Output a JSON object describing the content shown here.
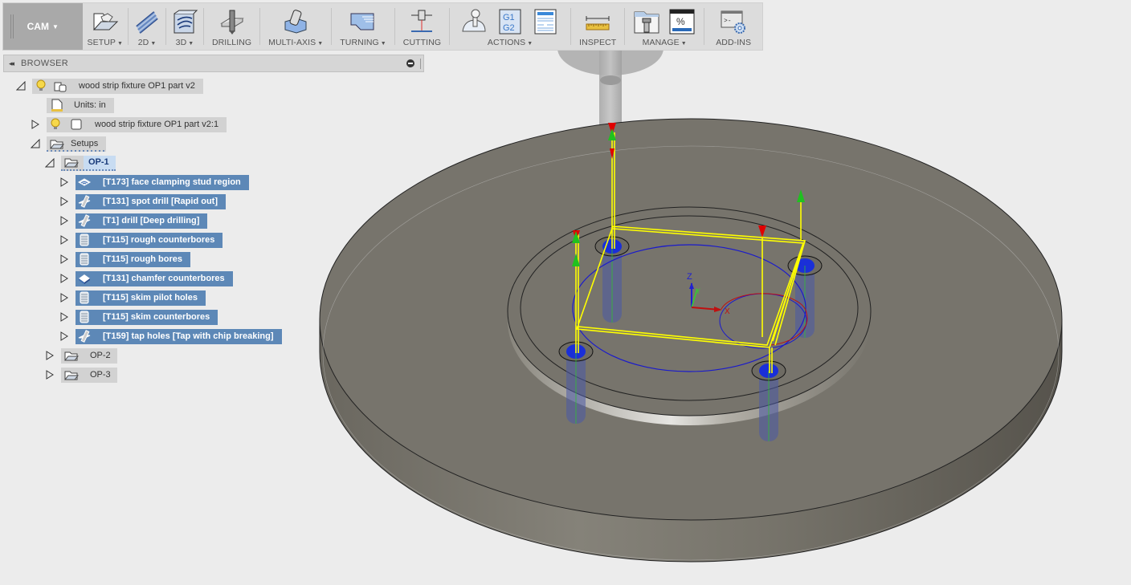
{
  "toolbar": {
    "workspace": "CAM",
    "groups": [
      {
        "label": "SETUP",
        "dropdown": true
      },
      {
        "label": "2D",
        "dropdown": true
      },
      {
        "label": "3D",
        "dropdown": true
      },
      {
        "label": "DRILLING",
        "dropdown": false
      },
      {
        "label": "MULTI-AXIS",
        "dropdown": true
      },
      {
        "label": "TURNING",
        "dropdown": true
      },
      {
        "label": "CUTTING",
        "dropdown": false
      },
      {
        "label": "ACTIONS",
        "dropdown": true
      },
      {
        "label": "INSPECT",
        "dropdown": false
      },
      {
        "label": "MANAGE",
        "dropdown": true
      },
      {
        "label": "ADD-INS",
        "dropdown": false
      }
    ],
    "icons": {
      "setup": "setup-icon",
      "2d": "2d-toolpath-icon",
      "3d": "3d-toolpath-icon",
      "drilling": "drilling-icon",
      "multiaxis": "multi-axis-icon",
      "turning": "turning-icon",
      "cutting": "cutting-icon",
      "actions": [
        "simulate-icon",
        "post-process-g1g2-icon",
        "setup-sheet-icon"
      ],
      "inspect": "measure-icon",
      "manage": [
        "tool-library-icon",
        "task-manager-icon"
      ],
      "addins": "scripts-addins-icon"
    },
    "caret": "▼"
  },
  "browser": {
    "title": "BROWSER",
    "collapse_glyph": "◂◂",
    "tree": {
      "root": "wood strip fixture OP1 part v2",
      "units": "Units: in",
      "component": "wood strip fixture OP1 part v2:1",
      "setups": "Setups",
      "op1": "OP-1",
      "operations": [
        {
          "label": "[T173] face clamping stud region",
          "icon": "face-operation-icon"
        },
        {
          "label": "[T131] spot drill [Rapid out]",
          "icon": "drill-operation-icon"
        },
        {
          "label": "[T1] drill [Deep drilling]",
          "icon": "drill-operation-icon"
        },
        {
          "label": "[T115] rough counterbores",
          "icon": "bore-operation-icon"
        },
        {
          "label": "[T115] rough bores",
          "icon": "bore-operation-icon"
        },
        {
          "label": "[T131] chamfer counterbores",
          "icon": "chamfer-operation-icon"
        },
        {
          "label": "[T115] skim pilot holes",
          "icon": "bore-operation-icon"
        },
        {
          "label": "[T115] skim counterbores",
          "icon": "bore-operation-icon"
        },
        {
          "label": "[T159] tap holes [Tap with chip breaking]",
          "icon": "tap-operation-icon"
        }
      ],
      "op2": "OP-2",
      "op3": "OP-3"
    }
  },
  "viewport": {
    "axes": {
      "x": "X",
      "y": "Y",
      "z": "Z"
    },
    "colors": {
      "part": "#77746c",
      "toolpath": "#ffff00",
      "rapid_down": "#e00000",
      "rapid_up": "#20c020",
      "holes": "#1a2fd8",
      "stock_circle": "#1a1acc",
      "selection_bg": "#5d88b7"
    }
  }
}
